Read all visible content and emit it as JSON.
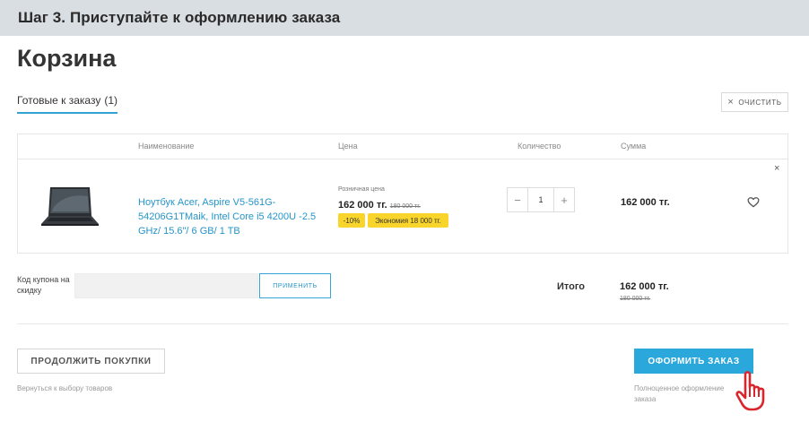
{
  "step_banner": "Шаг 3. Приступайте к оформлению заказа",
  "page_title": "Корзина",
  "tabs": {
    "ready_label": "Готовые к заказу",
    "ready_count": "(1)"
  },
  "clear_button": {
    "icon": "close-icon",
    "label": "ОЧИСТИТЬ"
  },
  "table": {
    "headers": {
      "name": "Наименование",
      "price": "Цена",
      "quantity": "Количество",
      "sum": "Сумма"
    },
    "items": [
      {
        "image_icon": "laptop-image",
        "name": "Ноутбук Acer, Aspire V5-561G-54206G1TMaik, Intel Core i5 4200U -2.5 GHz/ 15.6\"/ 6 GB/ 1 TB",
        "retail_label": "Розничная цена",
        "price": "162 000 тг.",
        "old_price": "180 000 тг.",
        "discount_badge": "-10%",
        "savings_badge": "Экономия 18 000 тг.",
        "quantity": "1",
        "minus": "−",
        "plus": "+",
        "sum": "162 000 тг.",
        "remove": "×",
        "favorite_icon": "heart-icon"
      }
    ]
  },
  "coupon": {
    "label": "Код купона на скидку",
    "value": "",
    "apply_label": "ПРИМЕНИТЬ"
  },
  "totals": {
    "label": "Итого",
    "sum": "162 000 тг.",
    "old_sum": "180 000 тг."
  },
  "continue": {
    "label": "ПРОДОЛЖИТЬ ПОКУПКИ",
    "hint": "Вернуться к выбору товаров"
  },
  "checkout": {
    "label": "ОФОРМИТЬ ЗАКАЗ",
    "hint": "Полноценное оформление заказа"
  },
  "cursor_icon": "hand-pointer-icon",
  "colors": {
    "accent": "#2aa8dc",
    "badge": "#f9d52b",
    "banner": "#d9dee3",
    "cursor": "#d8262c"
  }
}
